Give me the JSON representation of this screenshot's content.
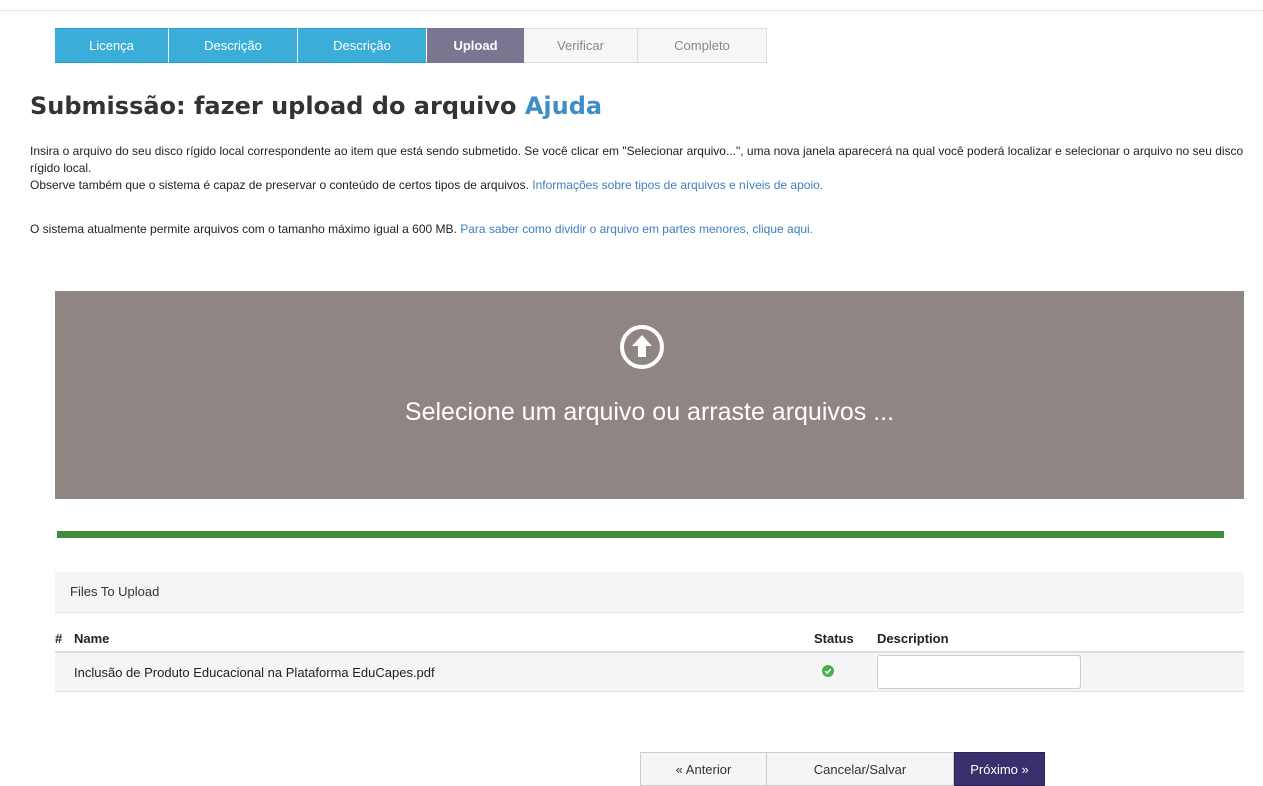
{
  "steps": [
    {
      "label": "Licença",
      "state": "done"
    },
    {
      "label": "Descrição",
      "state": "done"
    },
    {
      "label": "Descrição",
      "state": "done"
    },
    {
      "label": "Upload",
      "state": "current"
    },
    {
      "label": "Verificar",
      "state": "todo"
    },
    {
      "label": "Completo",
      "state": "todo"
    }
  ],
  "page": {
    "title": "Submissão: fazer upload do arquivo",
    "help_link": "Ajuda"
  },
  "intro": {
    "line1": "Insira o arquivo do seu disco rígido local correspondente ao item que está sendo submetido. Se você clicar em \"Selecionar arquivo...\", uma nova janela aparecerá na qual você poderá localizar e selecionar o arquivo no seu disco rígido local.",
    "line2": "Observe também que o sistema é capaz de preservar o conteúdo de certos tipos de arquivos.",
    "line2_link": "Informações sobre tipos de arquivos e níveis de apoio.",
    "limit_text": "O sistema atualmente permite arquivos com o tamanho máximo igual a 600 MB.",
    "limit_link": "Para saber como dividir o arquivo em partes menores, clique aqui."
  },
  "dropzone": {
    "text": "Selecione um arquivo ou arraste arquivos ...",
    "icon": "upload-arrow-circle-icon",
    "color": "#8f8684"
  },
  "progress": {
    "percent": 100,
    "color": "#3f8f3a"
  },
  "files": {
    "title": "Files To Upload",
    "headers": {
      "index": "#",
      "name": "Name",
      "status": "Status",
      "description": "Description"
    },
    "rows": [
      {
        "name": "Inclusão de Produto Educacional na Plataforma EduCapes.pdf",
        "status": "check-circle-icon",
        "description": ""
      }
    ]
  },
  "buttons": {
    "previous": "« Anterior",
    "save": "Cancelar/Salvar",
    "next": "Próximo »"
  },
  "colors": {
    "step_done": "#3aaed9",
    "step_current": "#7b7591",
    "link": "#3e8ec6",
    "next_button": "#3b2e6d"
  }
}
